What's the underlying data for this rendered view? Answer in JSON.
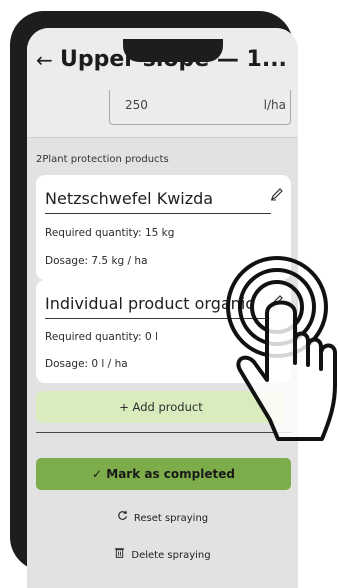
{
  "header": {
    "back_glyph": "←",
    "title": "Upper slope — 1..."
  },
  "quantity": {
    "value": "250",
    "unit": "l/ha"
  },
  "section": {
    "label": "2Plant protection products"
  },
  "products": [
    {
      "name": "Netzschwefel Kwizda",
      "required": "Required quantity: 15 kg",
      "dosage": "Dosage: 7.5 kg / ha",
      "icon": "pencil-icon"
    },
    {
      "name": "Individual product organic",
      "required": "Required quantity: 0 l",
      "dosage": "Dosage: 0 l / ha",
      "icon": "pencil-icon"
    }
  ],
  "actions": {
    "add_product": "+ Add product",
    "mark_completed": "✓ Mark as completed",
    "reset": "Reset spraying",
    "delete": "Delete spraying"
  },
  "icons": {
    "reset": "refresh-icon",
    "delete": "trash-icon",
    "gesture": "tap-hand-icon"
  },
  "colors": {
    "primary": "#7cad4a",
    "secondary": "#d8ecbd",
    "background": "#e2e2e2",
    "card": "#ffffff"
  }
}
